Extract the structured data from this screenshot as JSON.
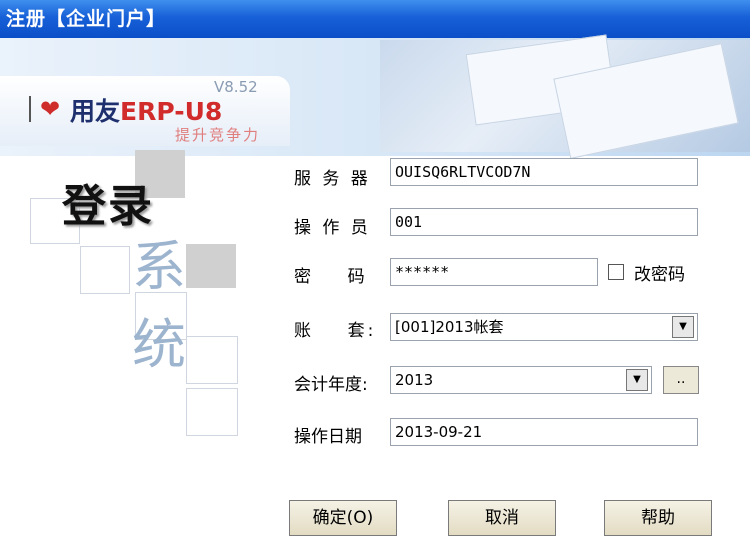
{
  "window": {
    "title": "注册【企业门户】"
  },
  "logo": {
    "version": "V8.52",
    "brand_cn": "用友",
    "brand_erp": "ERP-U8",
    "slogan": "提升竞争力"
  },
  "heading": {
    "main": "登录",
    "vertical_1": "系",
    "vertical_2": "统"
  },
  "form": {
    "server": {
      "label": "服 务 器",
      "value": "OUISQ6RLTVCOD7N"
    },
    "operator": {
      "label": "操 作 员",
      "value": "001"
    },
    "password": {
      "label": "密    码",
      "value": "******"
    },
    "change_password": {
      "label": "改密码",
      "checked": false
    },
    "account_set": {
      "label": "账    套:",
      "value": "[001]2013帐套"
    },
    "fiscal_year": {
      "label": "会计年度:",
      "value": "2013"
    },
    "browse_label": "..",
    "op_date": {
      "label": "操作日期",
      "value": "2013-09-21"
    }
  },
  "buttons": {
    "ok": "确定(O)",
    "cancel": "取消",
    "help": "帮助"
  },
  "colors": {
    "titlebar": "#1760d8",
    "brand_red": "#d12b2b",
    "button_face": "#ece9d8"
  }
}
